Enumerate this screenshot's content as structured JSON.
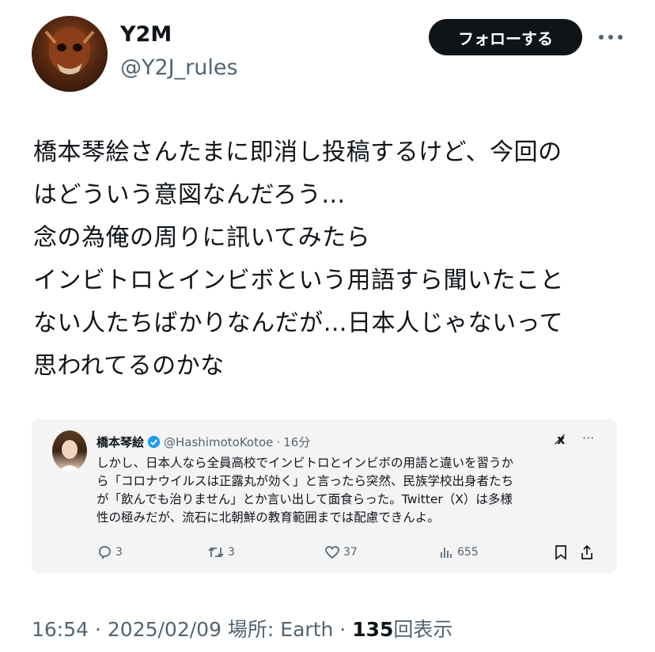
{
  "author": {
    "display_name": "Y2M",
    "handle": "@Y2J_rules"
  },
  "header": {
    "follow_label": "フォローする",
    "more_icon": "more-dots-icon"
  },
  "tweet": {
    "lines": [
      "橋本琴絵さんたまに即消し投稿するけど、今回の",
      "はどういう意図なんだろう…",
      "念の為俺の周りに訊いてみたら",
      "インビトロとインビボという用語すら聞いたこと",
      "ない人たちばかりなんだが…日本人じゃないって",
      "思われてるのかな"
    ]
  },
  "quote": {
    "name": "橋本琴絵",
    "handle": "@HashimotoKotoe",
    "separator": "·",
    "time": "16分",
    "xai_label": "x̸",
    "lines": [
      "しかし、日本人なら全員高校でインビトロとインビボの用語と違いを習うか",
      "ら「コロナウイルスは正露丸が効く」と言ったら突然、民族学校出身者たち",
      "が「飲んでも治りません」とか言い出して面食らった。Twitter（X）は多様",
      "性の極みだが、流石に北朝鮮の教育範囲までは配慮できんよ。"
    ],
    "actions": {
      "replies": "3",
      "reposts": "3",
      "likes": "37",
      "views": "655"
    }
  },
  "meta": {
    "timestamp": "16:54 · 2025/02/09 場所: Earth ·",
    "views_count": "135",
    "views_label": "回表示"
  },
  "colors": {
    "text": "#0f1419",
    "secondary": "#536471",
    "follow_bg": "#0f1419",
    "verified": "#1d9bf0",
    "card_bg": "#f4f4f5"
  }
}
